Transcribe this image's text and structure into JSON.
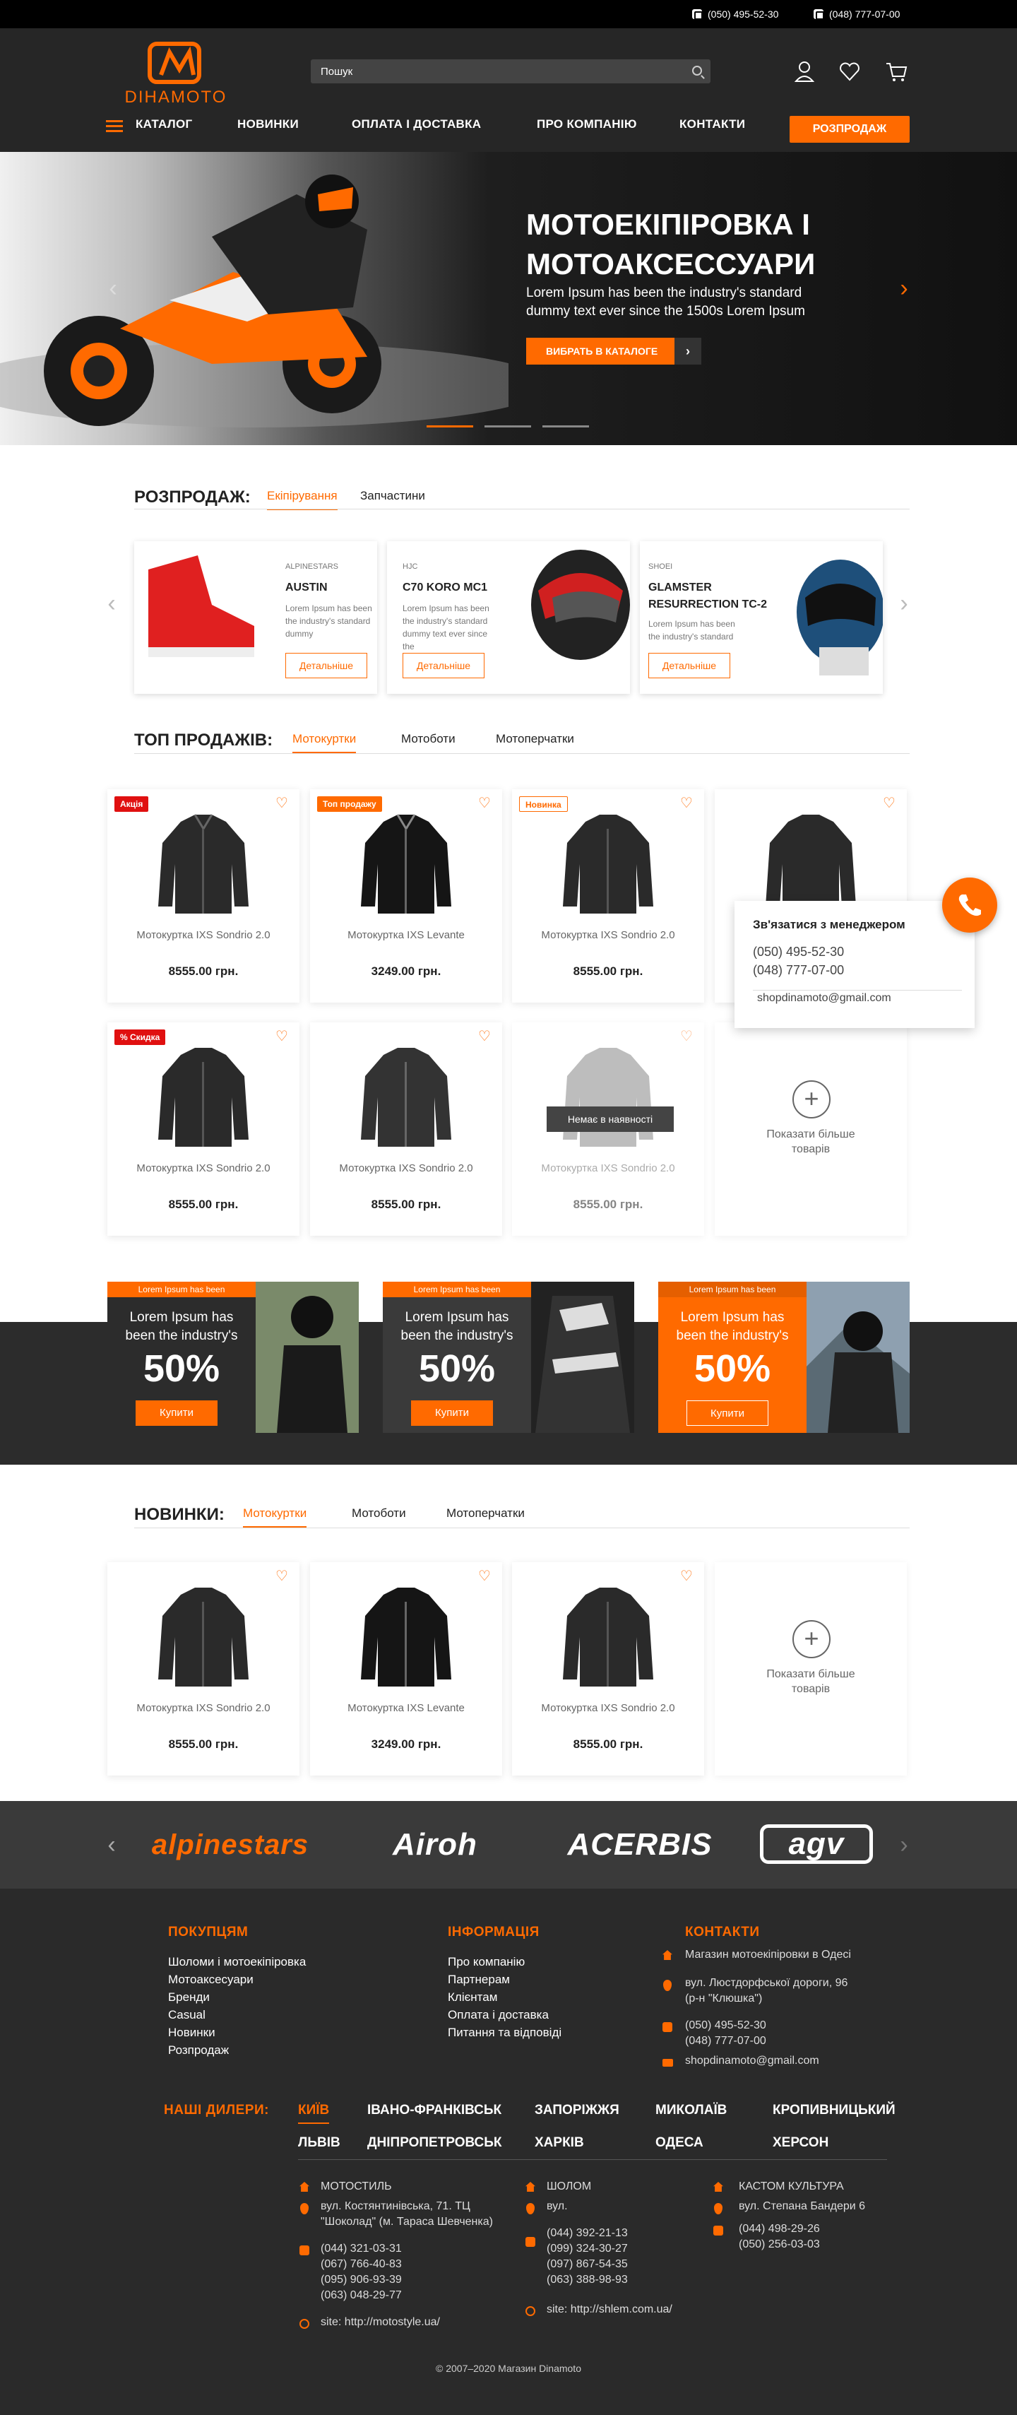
{
  "topbar": {
    "phone1": "(050) 495-52-30",
    "phone2": "(048) 777-07-00"
  },
  "header": {
    "logo_text": "DIHAMOTO",
    "search_placeholder": "Пошук",
    "nav": [
      "КАТАЛОГ",
      "НОВИНКИ",
      "ОПЛАТА І ДОСТАВКА",
      "ПРО КОМПАНІЮ",
      "КОНТАКТИ"
    ],
    "sale_button": "РОЗПРОДАЖ"
  },
  "hero": {
    "title": "МОТОЕКІПІРОВКА І МОТОАКСЕССУАРИ",
    "subtitle": "Lorem Ipsum has been the industry's standard dummy text ever since the 1500s Lorem Ipsum",
    "button": "ВИБРАТЬ В КАТАЛОГЕ",
    "arrow_glyph": "›"
  },
  "sale": {
    "title": "РОЗПРОДАЖ:",
    "tabs": [
      "Екіпірування",
      "Запчастини"
    ],
    "cards": [
      {
        "brand": "ALPINESTARS",
        "name": "AUSTIN",
        "desc": "Lorem Ipsum has been the industry's standard dummy",
        "button": "Детальніше"
      },
      {
        "brand": "HJC",
        "name": "C70 KORO MC1",
        "desc": "Lorem Ipsum has been the industry's standard dummy text ever since the",
        "button": "Детальніше"
      },
      {
        "brand": "SHOEI",
        "name": "GLAMSTER RESURRECTION TC-2",
        "desc": "Lorem Ipsum has been the industry's standard",
        "button": "Детальніше"
      }
    ]
  },
  "top": {
    "title": "ТОП ПРОДАЖІВ:",
    "tabs": [
      "Мотокуртки",
      "Мотоботи",
      "Мотоперчатки"
    ],
    "products": [
      {
        "badge": "Акція",
        "name": "Мотокуртка IXS Sondrio 2.0",
        "price": "8555.00 грн."
      },
      {
        "badge": "Топ продажу",
        "name": "Мотокуртка IXS Levante",
        "price": "3249.00 грн."
      },
      {
        "badge": "Новинка",
        "name": "Мотокуртка IXS Sondrio 2.0",
        "price": "8555.00 грн."
      },
      {
        "badge": "",
        "name": "",
        "price": ""
      },
      {
        "badge": "% Скидка",
        "name": "Мотокуртка IXS Sondrio 2.0",
        "price": "8555.00 грн."
      },
      {
        "badge": "",
        "name": "Мотокуртка IXS Sondrio 2.0",
        "price": "8555.00 грн."
      },
      {
        "badge": "",
        "name": "Мотокуртка IXS Sondrio 2.0",
        "price": "8555.00 грн.",
        "overlay": "Немає в наявності"
      }
    ],
    "more": "Показати більше товарів"
  },
  "contact": {
    "title": "Зв'язатися з менеджером",
    "phone1": "(050) 495-52-30",
    "phone2": "(048) 777-07-00",
    "email": "shopdinamoto@gmail.com"
  },
  "promos": [
    {
      "tag": "Lorem Ipsum has been",
      "text": "Lorem Ipsum has been the industry's",
      "pct": "50%",
      "button": "Купити"
    },
    {
      "tag": "Lorem Ipsum has been",
      "text": "Lorem Ipsum has been the industry's",
      "pct": "50%",
      "button": "Купити"
    },
    {
      "tag": "Lorem Ipsum has been",
      "text": "Lorem Ipsum has been the industry's",
      "pct": "50%",
      "button": "Купити"
    }
  ],
  "news": {
    "title": "НОВИНКИ:",
    "tabs": [
      "Мотокуртки",
      "Мотоботи",
      "Мотоперчатки"
    ],
    "products": [
      {
        "name": "Мотокуртка IXS Sondrio 2.0",
        "price": "8555.00 грн."
      },
      {
        "name": "Мотокуртка IXS Levante",
        "price": "3249.00 грн."
      },
      {
        "name": "Мотокуртка IXS Sondrio 2.0",
        "price": "8555.00 грн."
      }
    ],
    "more": "Показати більше товарів"
  },
  "brands": [
    "alpinestars",
    "Airoh",
    "ACERBIS",
    "agv"
  ],
  "footer": {
    "col1_title": "ПОКУПЦЯМ",
    "col1": [
      "Шоломи і мотоекіпіровка",
      "Мотоаксесуари",
      "Бренди",
      "Casual",
      "Новинки",
      "Розпродаж"
    ],
    "col2_title": "ІНФОРМАЦІЯ",
    "col2": [
      "Про компанію",
      "Партнерам",
      "Клієнтам",
      "Оплата і доставка",
      "Питання та відповіді"
    ],
    "col3_title": "КОНТАКТИ",
    "shop": "Магазин мотоекіпіровки в Одесі",
    "address": "вул. Люстдорфської дороги, 96 (р-н \"Клюшка\")",
    "phone1": "(050) 495-52-30",
    "phone2": "(048) 777-07-00",
    "email": "shopdinamoto@gmail.com",
    "dealers_title": "НАШІ ДИЛЕРИ:",
    "cities_row1": [
      "КИЇВ",
      "ІВАНО-ФРАНКІВСЬК",
      "ЗАПОРІЖЖЯ",
      "МИКОЛАЇВ",
      "КРОПИВНИЦЬКИЙ"
    ],
    "cities_row2": [
      "ЛЬВІВ",
      "ДНІПРОПЕТРОВСЬК",
      "ХАРКІВ",
      "ОДЕСА",
      "ХЕРСОН"
    ],
    "dealers": [
      {
        "name": "МОТОСТИЛЬ",
        "address": "вул. Костянтинівська, 71. ТЦ \"Шоколад\" (м. Тараса Шевченка)",
        "phones": "(044) 321-03-31\n(067) 766-40-83\n(095) 906-93-39\n(063) 048-29-77",
        "site": "site: http://motostyle.ua/"
      },
      {
        "name": "ШОЛОМ",
        "address": "вул.",
        "phones": "(044) 392-21-13\n(099) 324-30-27\n(097) 867-54-35\n(063) 388-98-93",
        "site": "site: http://shlem.com.ua/"
      },
      {
        "name": "КАСТОМ КУЛЬТУРА",
        "address": "вул. Степана Бандери 6",
        "phones": "(044) 498-29-26\n(050) 256-03-03",
        "site": ""
      }
    ],
    "copyright": "© 2007–2020 Магазин Dinamoto"
  }
}
